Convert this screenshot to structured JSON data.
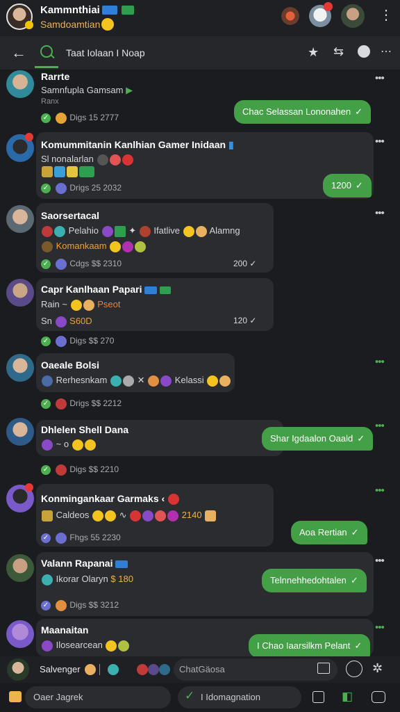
{
  "header": {
    "title": "Kammnthiai",
    "subtitle": "Samdoamtian",
    "back_icon": "arrow-left-icon",
    "menu_icon": "more-vertical-icon"
  },
  "search": {
    "query": "Taat Iolaan I Noap",
    "icons": [
      "star-icon",
      "share-icon",
      "compass-icon",
      "more-horizontal-icon"
    ]
  },
  "chats": [
    {
      "title": "Rarrte",
      "line1": "Samnfupla Gamsam",
      "line2": "Ranx",
      "meta": "Digs 15 2777",
      "reply": "Chac Selassan Lononahen"
    },
    {
      "title": "Komummitanin Kanlhian Gamer Inidaan",
      "line1": "Sl nonalarlan",
      "meta": "Drigs 25 2032",
      "reply": "1200"
    },
    {
      "title": "Saorsertacal",
      "line1": "Pelahio",
      "line1b": "Ifatlive",
      "line1c": "Alamng",
      "line2": "Komankaam",
      "meta": "Cdgs $$ 2310",
      "count": "200"
    },
    {
      "title": "Capr Kanlhaan Papari",
      "line1": "Rain ~",
      "line1b": "Pseot",
      "line2": "Sn",
      "line2b": "S60D",
      "meta": "Digs $$ 270",
      "count": "120"
    },
    {
      "title": "Oaeale Bolsi",
      "line1": "Rerhesnkam",
      "line1b": "Kelassi",
      "meta": "Drigs $$ 2212"
    },
    {
      "title": "Dhlelen Shell Dana",
      "line1": "~ o",
      "meta": "Digs $$ 2210",
      "reply": "Shar Igdaalon Oaald"
    },
    {
      "title": "Konmingankaar Garmaks",
      "line1": "Caldeos",
      "line1b": "2140",
      "meta": "Fhgs 55 2230",
      "reply": "Aoa Rertian"
    },
    {
      "title": "Valann Rapanai",
      "line1": "Ikorar Olaryn",
      "line1b": "$ 180",
      "meta": "Digs $$ 3212",
      "reply": "Telnnehhedohtalen"
    },
    {
      "title": "Maanaitan",
      "line1": "Ilosearcean",
      "reply": "I Chao Iaarsilkm Pelant"
    }
  ],
  "composer": {
    "name": "Salvenger",
    "placeholder": "ChatGäosa",
    "left_label": "Oaer Jagrek",
    "middle_label": "I Idomagnation"
  },
  "colors": {
    "accent": "#43a047",
    "background": "#1b1c1f",
    "card": "#2b2c30"
  }
}
